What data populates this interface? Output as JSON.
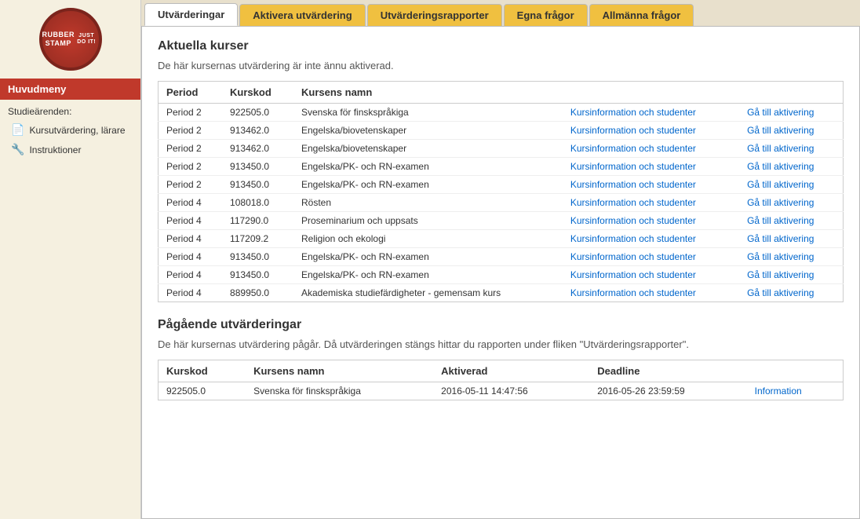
{
  "logo": {
    "line1": "RUBBER",
    "line2": "STAMP",
    "line3": "JUST DO IT!"
  },
  "sidebar": {
    "menu_header": "Huvudmeny",
    "section_label": "Studieärenden:",
    "items": [
      {
        "icon": "📄",
        "label": "Kursutvärdering, lärare"
      },
      {
        "icon": "🔧",
        "label": "Instruktioner"
      }
    ]
  },
  "tabs": [
    {
      "label": "Utvärderingar",
      "active": true
    },
    {
      "label": "Aktivera utvärdering",
      "active": false
    },
    {
      "label": "Utvärderingsrapporter",
      "active": false
    },
    {
      "label": "Egna frågor",
      "active": false
    },
    {
      "label": "Allmänna frågor",
      "active": false
    }
  ],
  "section1": {
    "heading": "Aktuella kurser",
    "description": "De här kursernas utvärdering är inte ännu aktiverad.",
    "table_headers": [
      "Period",
      "Kurskod",
      "Kursens namn",
      "",
      ""
    ],
    "rows": [
      {
        "period": "Period 2",
        "kurskod": "922505.0",
        "kursnamn": "Svenska för finskspråkiga",
        "link1": "Kursinformation och studenter",
        "link2": "Gå till aktivering"
      },
      {
        "period": "Period 2",
        "kurskod": "913462.0",
        "kursnamn": "Engelska/biovetenskaper",
        "link1": "Kursinformation och studenter",
        "link2": "Gå till aktivering"
      },
      {
        "period": "Period 2",
        "kurskod": "913462.0",
        "kursnamn": "Engelska/biovetenskaper",
        "link1": "Kursinformation och studenter",
        "link2": "Gå till aktivering"
      },
      {
        "period": "Period 2",
        "kurskod": "913450.0",
        "kursnamn": "Engelska/PK- och RN-examen",
        "link1": "Kursinformation och studenter",
        "link2": "Gå till aktivering"
      },
      {
        "period": "Period 2",
        "kurskod": "913450.0",
        "kursnamn": "Engelska/PK- och RN-examen",
        "link1": "Kursinformation och studenter",
        "link2": "Gå till aktivering"
      },
      {
        "period": "Period 4",
        "kurskod": "108018.0",
        "kursnamn": "Rösten",
        "link1": "Kursinformation och studenter",
        "link2": "Gå till aktivering"
      },
      {
        "period": "Period 4",
        "kurskod": "117290.0",
        "kursnamn": "Proseminarium och uppsats",
        "link1": "Kursinformation och studenter",
        "link2": "Gå till aktivering"
      },
      {
        "period": "Period 4",
        "kurskod": "117209.2",
        "kursnamn": "Religion och ekologi",
        "link1": "Kursinformation och studenter",
        "link2": "Gå till aktivering"
      },
      {
        "period": "Period 4",
        "kurskod": "913450.0",
        "kursnamn": "Engelska/PK- och RN-examen",
        "link1": "Kursinformation och studenter",
        "link2": "Gå till aktivering"
      },
      {
        "period": "Period 4",
        "kurskod": "913450.0",
        "kursnamn": "Engelska/PK- och RN-examen",
        "link1": "Kursinformation och studenter",
        "link2": "Gå till aktivering"
      },
      {
        "period": "Period 4",
        "kurskod": "889950.0",
        "kursnamn": "Akademiska studiefärdigheter - gemensam kurs",
        "link1": "Kursinformation och studenter",
        "link2": "Gå till aktivering"
      }
    ]
  },
  "section2": {
    "heading": "Pågående utvärderingar",
    "description": "De här kursernas utvärdering pågår. Då utvärderingen stängs hittar du rapporten under fliken \"Utvärderingsrapporter\".",
    "table_headers": [
      "Kurskod",
      "Kursens namn",
      "Aktiverad",
      "Deadline",
      ""
    ],
    "rows": [
      {
        "kurskod": "922505.0",
        "kursnamn": "Svenska för finskspråkiga",
        "aktiverad": "2016-05-11 14:47:56",
        "deadline": "2016-05-26 23:59:59",
        "link": "Information"
      }
    ]
  }
}
